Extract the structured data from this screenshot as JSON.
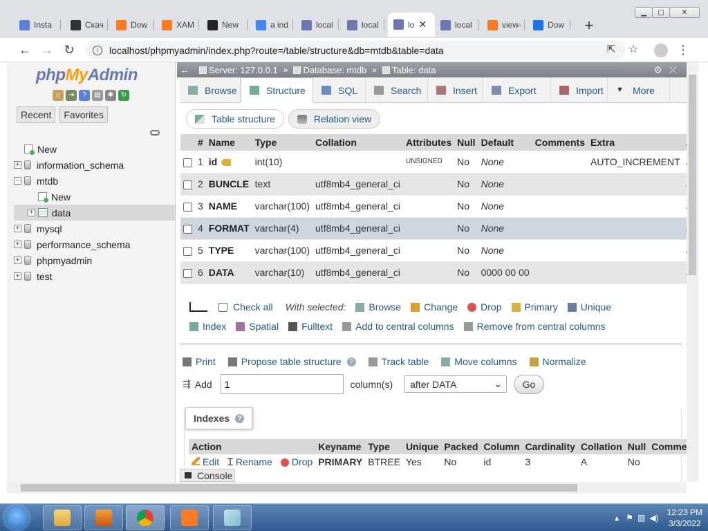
{
  "browser": {
    "tabs": [
      {
        "label": "Insta",
        "icon": "gear-icon",
        "color": "#5b7fd6"
      },
      {
        "label": "Скач",
        "icon": "terminal-icon",
        "color": "#333333"
      },
      {
        "label": "Dow",
        "icon": "xampp-icon",
        "color": "#fb7a24"
      },
      {
        "label": "XAM",
        "icon": "xampp-icon",
        "color": "#fb7a24"
      },
      {
        "label": "New",
        "icon": "github-icon",
        "color": "#222222"
      },
      {
        "label": "a ind",
        "icon": "google-icon",
        "color": "#4285f4"
      },
      {
        "label": "local",
        "icon": "pma-icon",
        "color": "#6c78af"
      },
      {
        "label": "local",
        "icon": "pma-icon",
        "color": "#6c78af"
      },
      {
        "label": "lo",
        "icon": "pma-icon",
        "color": "#6c78af"
      },
      {
        "label": "local",
        "icon": "pma-icon",
        "color": "#6c78af"
      },
      {
        "label": "view-",
        "icon": "xampp-icon",
        "color": "#fb7a24"
      },
      {
        "label": "Dow",
        "icon": "download-icon",
        "color": "#1a73e8"
      }
    ],
    "active_tab_index": 8,
    "url": "localhost/phpmyadmin/index.php?route=/table/structure&db=mtdb&table=data"
  },
  "nav": {
    "logo": {
      "php": "php",
      "my": "My",
      "admin": "Admin"
    },
    "tabs": [
      "Recent",
      "Favorites"
    ],
    "tree": [
      {
        "label": "New",
        "level": 0,
        "type": "new"
      },
      {
        "label": "information_schema",
        "level": 0,
        "type": "db",
        "expander": "+"
      },
      {
        "label": "mtdb",
        "level": 0,
        "type": "db",
        "expander": "−"
      },
      {
        "label": "New",
        "level": 1,
        "type": "new"
      },
      {
        "label": "data",
        "level": 1,
        "type": "table",
        "expander": "+",
        "selected": true
      },
      {
        "label": "mysql",
        "level": 0,
        "type": "db",
        "expander": "+"
      },
      {
        "label": "performance_schema",
        "level": 0,
        "type": "db",
        "expander": "+"
      },
      {
        "label": "phpmyadmin",
        "level": 0,
        "type": "db",
        "expander": "+"
      },
      {
        "label": "test",
        "level": 0,
        "type": "db",
        "expander": "+"
      }
    ]
  },
  "breadcrumb": {
    "server": "Server: 127.0.0.1",
    "database": "Database: mtdb",
    "table": "Table: data"
  },
  "menu": [
    "Browse",
    "Structure",
    "SQL",
    "Search",
    "Insert",
    "Export",
    "Import",
    "More"
  ],
  "menu_active": "Structure",
  "subtabs": [
    "Table structure",
    "Relation view"
  ],
  "structure": {
    "headers": [
      "#",
      "Name",
      "Type",
      "Collation",
      "Attributes",
      "Null",
      "Default",
      "Comments",
      "Extra",
      "Acti"
    ],
    "rows": [
      {
        "num": "1",
        "name": "id",
        "type": "int(10)",
        "collation": "",
        "attributes": "UNSIGNED",
        "null": "No",
        "default": "None",
        "extra": "AUTO_INCREMENT",
        "key": true
      },
      {
        "num": "2",
        "name": "BUNCLE",
        "type": "text",
        "collation": "utf8mb4_general_ci",
        "attributes": "",
        "null": "No",
        "default": "None",
        "extra": ""
      },
      {
        "num": "3",
        "name": "NAME",
        "type": "varchar(100)",
        "collation": "utf8mb4_general_ci",
        "attributes": "",
        "null": "No",
        "default": "None",
        "extra": ""
      },
      {
        "num": "4",
        "name": "FORMAT",
        "type": "varchar(4)",
        "collation": "utf8mb4_general_ci",
        "attributes": "",
        "null": "No",
        "default": "None",
        "extra": ""
      },
      {
        "num": "5",
        "name": "TYPE",
        "type": "varchar(100)",
        "collation": "utf8mb4_general_ci",
        "attributes": "",
        "null": "No",
        "default": "None",
        "extra": ""
      },
      {
        "num": "6",
        "name": "DATA",
        "type": "varchar(10)",
        "collation": "utf8mb4_general_ci",
        "attributes": "",
        "null": "No",
        "default": "0000 00 00",
        "extra": ""
      }
    ]
  },
  "bulk": {
    "check_all": "Check all",
    "with_selected": "With selected:",
    "actions_row1": [
      "Browse",
      "Change",
      "Drop",
      "Primary",
      "Unique"
    ],
    "actions_row2": [
      "Index",
      "Spatial",
      "Fulltext",
      "Add to central columns",
      "Remove from central columns"
    ]
  },
  "tools": [
    "Print",
    "Propose table structure",
    "Track table",
    "Move columns",
    "Normalize"
  ],
  "add_column": {
    "label": "Add",
    "value": "1",
    "unit": "column(s)",
    "position": "after DATA",
    "go": "Go"
  },
  "indexes": {
    "title": "Indexes",
    "headers": [
      "Action",
      "Keyname",
      "Type",
      "Unique",
      "Packed",
      "Column",
      "Cardinality",
      "Collation",
      "Null",
      "Commen"
    ],
    "rows": [
      {
        "edit": "Edit",
        "rename": "Rename",
        "drop": "Drop",
        "keyname": "PRIMARY",
        "type": "BTREE",
        "unique": "Yes",
        "packed": "No",
        "column": "id",
        "cardinality": "3",
        "collation": "A",
        "null": "No"
      }
    ]
  },
  "console": "Console",
  "taskbar": {
    "time": "12:23 PM",
    "date": "3/3/2022"
  }
}
